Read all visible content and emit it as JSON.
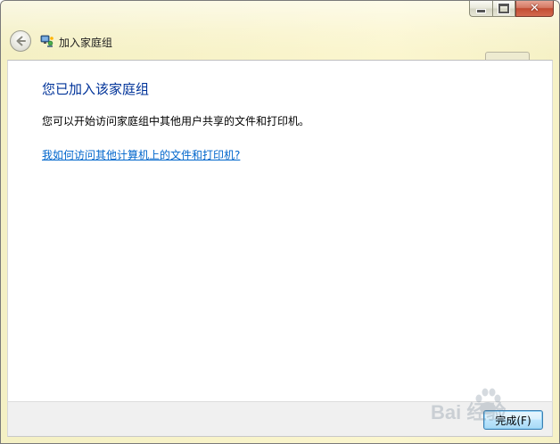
{
  "window": {
    "title": "加入家庭组",
    "controls": {
      "minimize_icon": "minimize-icon",
      "maximize_icon": "maximize-icon",
      "close_icon": "close-icon"
    }
  },
  "header": {
    "back_icon": "back-arrow-icon",
    "app_icon": "homegroup-icon"
  },
  "content": {
    "heading": "您已加入该家庭组",
    "description": "您可以开始访问家庭组中其他用户共享的文件和打印机。",
    "help_link": "我如何访问其他计算机上的文件和打印机?"
  },
  "footer": {
    "finish_button": "完成(F)"
  },
  "watermark": {
    "text": "Bai 经验"
  },
  "colors": {
    "heading": "#003399",
    "link": "#0066cc",
    "chrome": "#f8f3c9",
    "close_button": "#c24c32",
    "primary_button_border": "#3c7fb1"
  }
}
